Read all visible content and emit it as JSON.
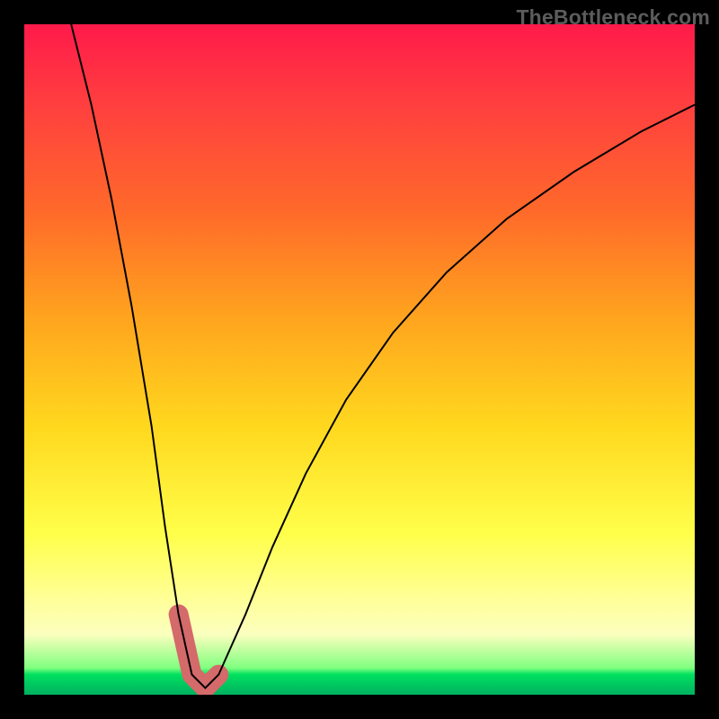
{
  "watermark": "TheBottleneck.com",
  "chart_data": {
    "type": "line",
    "title": "",
    "xlabel": "",
    "ylabel": "",
    "xlim": [
      0,
      100
    ],
    "ylim": [
      0,
      100
    ],
    "series": [
      {
        "name": "bottleneck-curve",
        "x": [
          7,
          10,
          13,
          16,
          19,
          21,
          23,
          25,
          27,
          29,
          33,
          37,
          42,
          48,
          55,
          63,
          72,
          82,
          92,
          100
        ],
        "y": [
          100,
          88,
          74,
          58,
          40,
          25,
          12,
          3,
          1,
          3,
          12,
          22,
          33,
          44,
          54,
          63,
          71,
          78,
          84,
          88
        ]
      }
    ],
    "highlight_range": {
      "x": [
        22.5,
        30
      ],
      "note": "green-zone bottom of V"
    },
    "background": "rainbow-vertical-gradient"
  }
}
